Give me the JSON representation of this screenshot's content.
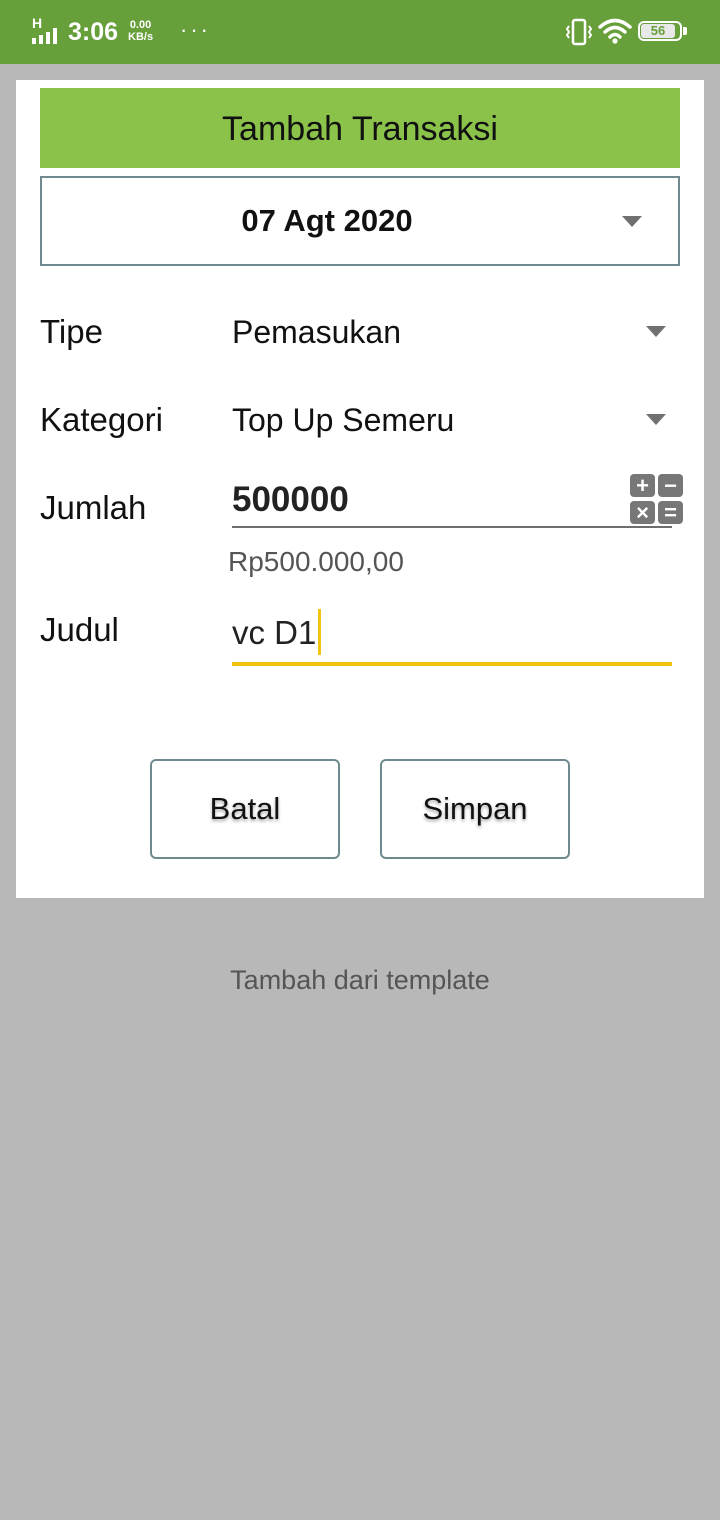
{
  "status_bar": {
    "network": "H",
    "time": "3:06",
    "speed_value": "0.00",
    "speed_unit": "KB/s",
    "more": "···",
    "battery": "56",
    "icons": [
      "signal-icon",
      "vibrate-icon",
      "wifi-icon",
      "battery-icon"
    ]
  },
  "dialog": {
    "title": "Tambah Transaksi",
    "date": "07 Agt 2020",
    "fields": {
      "type_label": "Tipe",
      "type_value": "Pemasukan",
      "category_label": "Kategori",
      "category_value": "Top Up Semeru",
      "amount_label": "Jumlah",
      "amount_value": "500000",
      "amount_formatted": "Rp500.000,00",
      "title_label": "Judul",
      "title_value": "vc D1"
    },
    "calculator_keys": {
      "plus": "+",
      "minus": "−",
      "times": "×",
      "equals": "="
    },
    "buttons": {
      "cancel": "Batal",
      "save": "Simpan"
    }
  },
  "template_link": "Tambah dari template",
  "colors": {
    "status_bar": "#679f3a",
    "title_bar": "#8bc34a",
    "focus_underline": "#f1c40f",
    "backdrop": "#b8b8b8"
  }
}
